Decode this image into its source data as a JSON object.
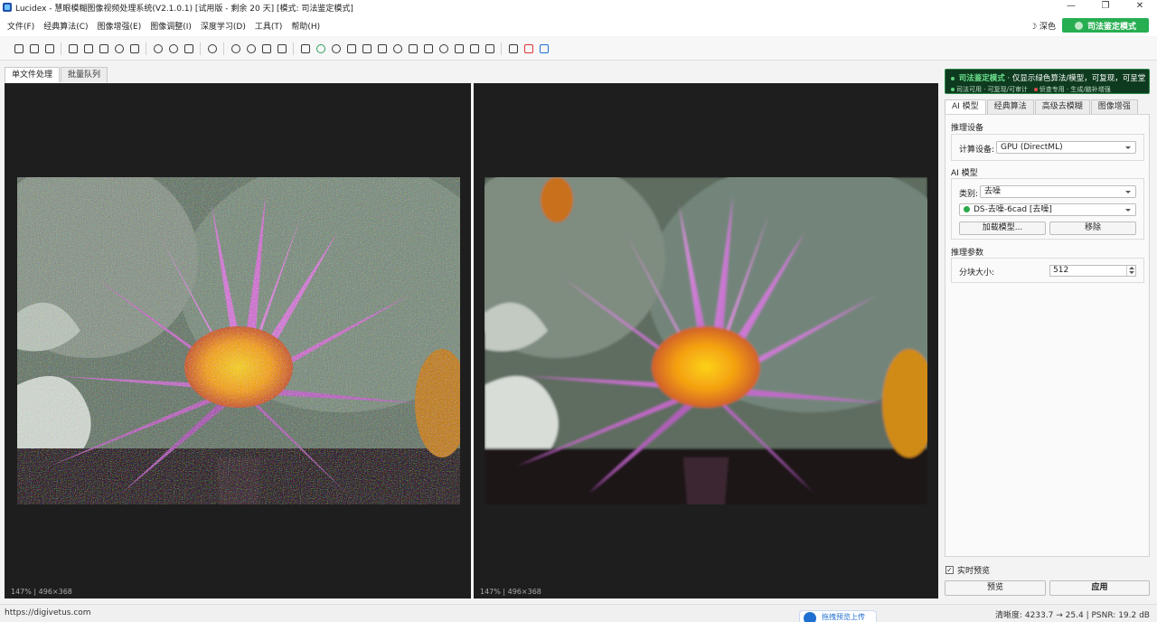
{
  "window": {
    "title": "Lucidex - 慧眼模糊图像视频处理系统(V2.1.0.1)  [试用版 - 剩余 20 天]  [模式: 司法鉴定模式]",
    "minimize": "—",
    "maximize": "❐",
    "close": "✕"
  },
  "menu": {
    "items": [
      "文件(F)",
      "经典算法(C)",
      "图像增强(E)",
      "图像调整(I)",
      "深度学习(D)",
      "工具(T)",
      "帮助(H)"
    ],
    "theme_toggle": "☽ 深色",
    "forensic_mode_button": "司法鉴定模式"
  },
  "toolbar": {
    "icons": [
      "open-folder-icon",
      "open-file-icon",
      "save-icon",
      "wand-icon",
      "trophy-icon",
      "print-icon",
      "smile-icon",
      "compare-icon",
      "undo-icon",
      "redo-icon",
      "split-view-icon",
      "refresh-icon",
      "rotate-left-icon",
      "rotate-right-icon",
      "flip-horizontal-icon",
      "flip-vertical-icon",
      "histogram-icon",
      "color-icon",
      "sun-icon",
      "image-icon",
      "filter-icon",
      "layers-icon",
      "brightness-icon",
      "curve-icon",
      "levels-icon",
      "contrast-icon",
      "crop-icon",
      "rect-icon",
      "frame-icon",
      "select-icon",
      "clear-icon",
      "crop-blue-icon"
    ]
  },
  "left_tabs": [
    "单文件处理",
    "批量队列"
  ],
  "panes": {
    "left_info": "147%  |  496×368",
    "right_info": "147%  |  496×368"
  },
  "banner": {
    "mode": "司法鉴定模式",
    "desc": " · 仅显示绿色算法/模型，可复现，可呈堂",
    "legend_green": "司法可用 · 可复现/可审计",
    "legend_red": "侦查专用 · 生成/脑补增强"
  },
  "right_tabs": [
    "AI 模型",
    "经典算法",
    "高级去模糊",
    "图像增强"
  ],
  "settings": {
    "device_group": "推理设备",
    "device_label": "计算设备:",
    "device_value": "GPU (DirectML)",
    "model_group": "AI 模型",
    "category_label": "类别:",
    "category_value": "去噪",
    "model_value": "DS-去噪-6cad [去噪]",
    "load_model": "加载模型...",
    "remove": "移除",
    "params_group": "推理参数",
    "tile_label": "分块大小:",
    "tile_value": "512"
  },
  "actions": {
    "live_preview": "实时预览",
    "live_preview_checked": true,
    "preview": "预览",
    "apply": "应用"
  },
  "status": {
    "url": "https://digivetus.com",
    "upload_label": "拖拽预览上传",
    "metrics": "清晰度: 4233.7 → 25.4  |  PSNR: 19.2 dB"
  },
  "colors": {
    "accent_green": "#27ae52",
    "banner_bg": "#0e3b1f",
    "pane_bg": "#1e1e1e"
  }
}
